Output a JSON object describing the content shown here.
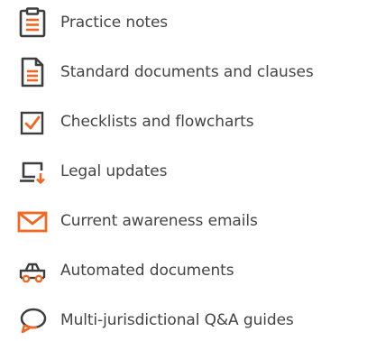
{
  "accent_color": "#f26522",
  "icon_outline_color": "#3d3d3d",
  "items": [
    {
      "label": "Practice notes",
      "icon": "clipboard-notes-icon"
    },
    {
      "label": "Standard documents and clauses",
      "icon": "document-icon"
    },
    {
      "label": "Checklists and flowcharts",
      "icon": "checkbox-icon"
    },
    {
      "label": "Legal updates",
      "icon": "laptop-download-icon"
    },
    {
      "label": "Current awareness emails",
      "icon": "envelope-icon"
    },
    {
      "label": "Automated documents",
      "icon": "car-icon"
    },
    {
      "label": "Multi-jurisdictional Q&A guides",
      "icon": "speech-bubbles-icon"
    }
  ]
}
